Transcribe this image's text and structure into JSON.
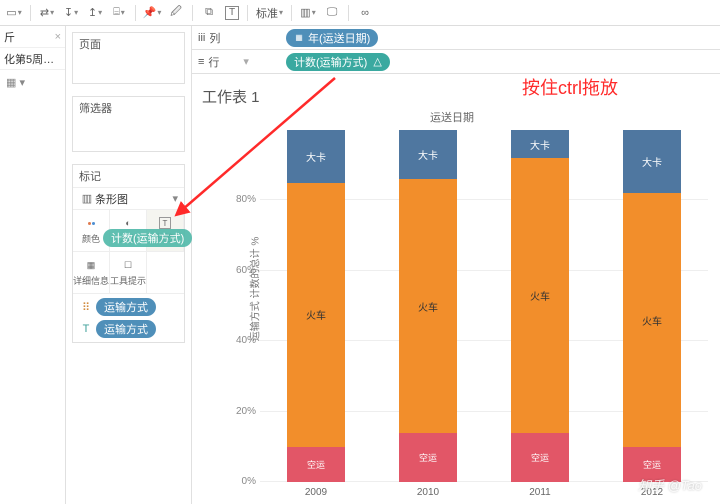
{
  "toolbar": {
    "standard_label": "标准"
  },
  "leftcol": {
    "analysis": "斤",
    "vis_item": "化第5周…",
    "grid": "▦ ▾"
  },
  "sidepanel": {
    "pages_label": "页面",
    "filters_label": "筛选器",
    "marks_label": "标记",
    "marks_type": "条形图",
    "cells": {
      "color": "颜色",
      "size": "大小",
      "label": "标签",
      "detail": "详细信息",
      "tooltip": "工具提示"
    },
    "drag_pill": "计数(运输方式)",
    "shelf_pills": [
      "运输方式",
      "运输方式"
    ]
  },
  "shelves": {
    "columns_label": "列",
    "columns_pill": "年(运送日期)",
    "rows_label": "行",
    "rows_pill": "计数(运输方式)",
    "rows_warn": "△"
  },
  "chart_title": "工作表 1",
  "annotation": "按住ctrl拖放",
  "subtitle": "运送日期",
  "ylabel": "运输方式 计数的总计 %",
  "categories_labels": {
    "truck": "大卡",
    "train": "火车",
    "air": "空运"
  },
  "watermark": "知乎 @Tao",
  "chart_data": {
    "type": "bar",
    "subtype": "stacked-percent",
    "xlabel": "运送日期",
    "ylabel": "运输方式 计数的总计 %",
    "ylim": [
      0,
      100
    ],
    "categories": [
      "2009",
      "2010",
      "2011",
      "2012"
    ],
    "series": [
      {
        "name": "大卡",
        "color": "#4f77a0",
        "values": [
          15,
          14,
          8,
          18
        ]
      },
      {
        "name": "火车",
        "color": "#f28e2b",
        "values": [
          75,
          72,
          78,
          72
        ]
      },
      {
        "name": "空运",
        "color": "#e25667",
        "values": [
          10,
          14,
          14,
          10
        ]
      }
    ],
    "yticks": [
      0,
      20,
      40,
      60,
      80,
      100
    ]
  },
  "yticks_display": [
    "0%",
    "20%",
    "40%",
    "60%",
    "80%"
  ]
}
